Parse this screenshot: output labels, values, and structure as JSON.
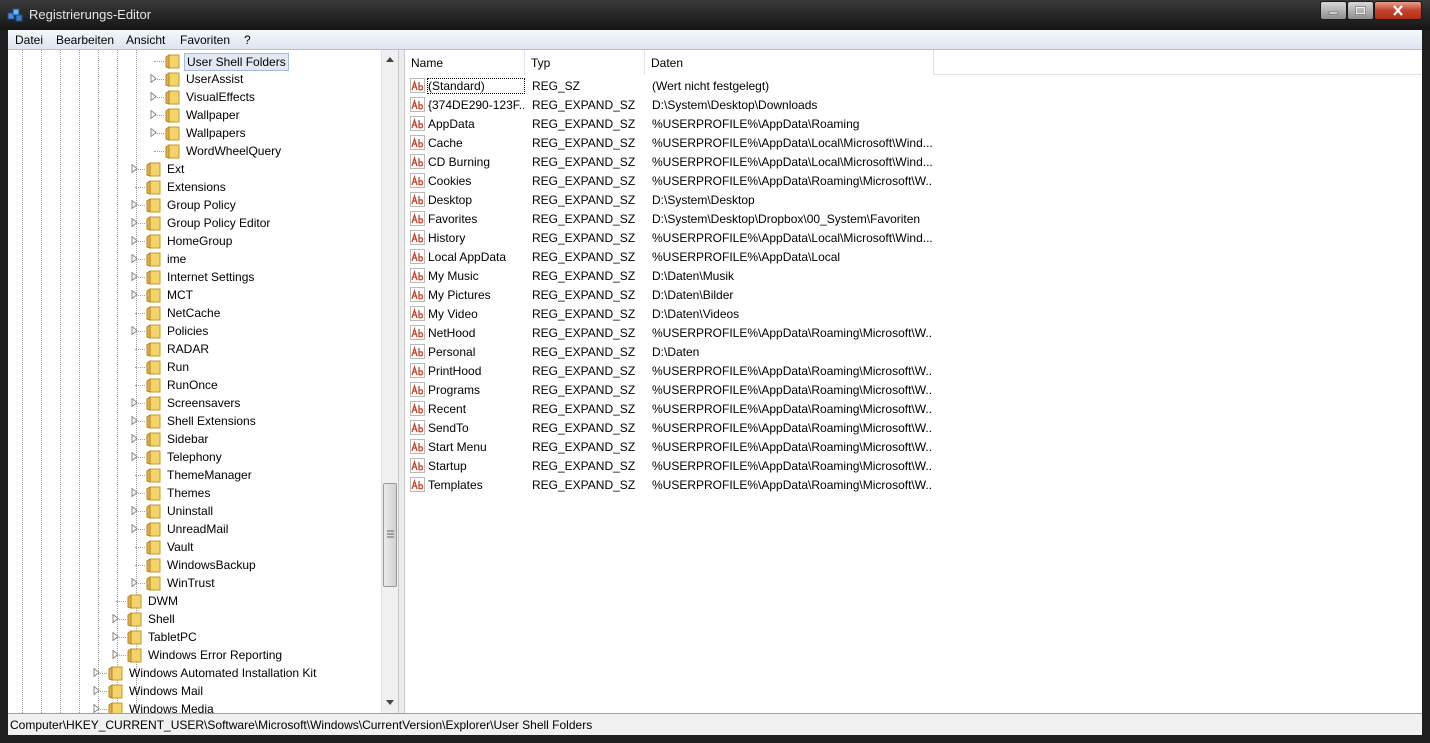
{
  "window": {
    "title": "Registrierungs-Editor"
  },
  "menu": [
    "Datei",
    "Bearbeiten",
    "Ansicht",
    "Favoriten",
    "?"
  ],
  "tree": {
    "nodes": [
      {
        "label": "User Shell Folders",
        "depth": 3,
        "expander": false,
        "selected": true
      },
      {
        "label": "UserAssist",
        "depth": 3,
        "expander": true
      },
      {
        "label": "VisualEffects",
        "depth": 3,
        "expander": true
      },
      {
        "label": "Wallpaper",
        "depth": 3,
        "expander": true
      },
      {
        "label": "Wallpapers",
        "depth": 3,
        "expander": true
      },
      {
        "label": "WordWheelQuery",
        "depth": 3,
        "expander": false
      },
      {
        "label": "Ext",
        "depth": 2,
        "expander": true
      },
      {
        "label": "Extensions",
        "depth": 2,
        "expander": false
      },
      {
        "label": "Group Policy",
        "depth": 2,
        "expander": true
      },
      {
        "label": "Group Policy Editor",
        "depth": 2,
        "expander": true
      },
      {
        "label": "HomeGroup",
        "depth": 2,
        "expander": true
      },
      {
        "label": "ime",
        "depth": 2,
        "expander": true
      },
      {
        "label": "Internet Settings",
        "depth": 2,
        "expander": true
      },
      {
        "label": "MCT",
        "depth": 2,
        "expander": true
      },
      {
        "label": "NetCache",
        "depth": 2,
        "expander": false
      },
      {
        "label": "Policies",
        "depth": 2,
        "expander": true
      },
      {
        "label": "RADAR",
        "depth": 2,
        "expander": false
      },
      {
        "label": "Run",
        "depth": 2,
        "expander": false
      },
      {
        "label": "RunOnce",
        "depth": 2,
        "expander": false
      },
      {
        "label": "Screensavers",
        "depth": 2,
        "expander": true
      },
      {
        "label": "Shell Extensions",
        "depth": 2,
        "expander": true
      },
      {
        "label": "Sidebar",
        "depth": 2,
        "expander": true
      },
      {
        "label": "Telephony",
        "depth": 2,
        "expander": true
      },
      {
        "label": "ThemeManager",
        "depth": 2,
        "expander": false
      },
      {
        "label": "Themes",
        "depth": 2,
        "expander": true
      },
      {
        "label": "Uninstall",
        "depth": 2,
        "expander": true
      },
      {
        "label": "UnreadMail",
        "depth": 2,
        "expander": true
      },
      {
        "label": "Vault",
        "depth": 2,
        "expander": false
      },
      {
        "label": "WindowsBackup",
        "depth": 2,
        "expander": false
      },
      {
        "label": "WinTrust",
        "depth": 2,
        "expander": true
      },
      {
        "label": "DWM",
        "depth": 1,
        "expander": false
      },
      {
        "label": "Shell",
        "depth": 1,
        "expander": true
      },
      {
        "label": "TabletPC",
        "depth": 1,
        "expander": true
      },
      {
        "label": "Windows Error Reporting",
        "depth": 1,
        "expander": true
      },
      {
        "label": "Windows Automated Installation Kit",
        "depth": 0,
        "expander": true
      },
      {
        "label": "Windows Mail",
        "depth": 0,
        "expander": true
      },
      {
        "label": "Windows Media",
        "depth": 0,
        "expander": true
      }
    ]
  },
  "list": {
    "columns": [
      "Name",
      "Typ",
      "Daten"
    ],
    "rows": [
      {
        "name": "(Standard)",
        "type": "REG_SZ",
        "data": "(Wert nicht festgelegt)"
      },
      {
        "name": "{374DE290-123F...",
        "type": "REG_EXPAND_SZ",
        "data": "D:\\System\\Desktop\\Downloads"
      },
      {
        "name": "AppData",
        "type": "REG_EXPAND_SZ",
        "data": "%USERPROFILE%\\AppData\\Roaming"
      },
      {
        "name": "Cache",
        "type": "REG_EXPAND_SZ",
        "data": "%USERPROFILE%\\AppData\\Local\\Microsoft\\Wind..."
      },
      {
        "name": "CD Burning",
        "type": "REG_EXPAND_SZ",
        "data": "%USERPROFILE%\\AppData\\Local\\Microsoft\\Wind..."
      },
      {
        "name": "Cookies",
        "type": "REG_EXPAND_SZ",
        "data": "%USERPROFILE%\\AppData\\Roaming\\Microsoft\\W..."
      },
      {
        "name": "Desktop",
        "type": "REG_EXPAND_SZ",
        "data": "D:\\System\\Desktop"
      },
      {
        "name": "Favorites",
        "type": "REG_EXPAND_SZ",
        "data": "D:\\System\\Desktop\\Dropbox\\00_System\\Favoriten"
      },
      {
        "name": "History",
        "type": "REG_EXPAND_SZ",
        "data": "%USERPROFILE%\\AppData\\Local\\Microsoft\\Wind..."
      },
      {
        "name": "Local AppData",
        "type": "REG_EXPAND_SZ",
        "data": "%USERPROFILE%\\AppData\\Local"
      },
      {
        "name": "My Music",
        "type": "REG_EXPAND_SZ",
        "data": "D:\\Daten\\Musik"
      },
      {
        "name": "My Pictures",
        "type": "REG_EXPAND_SZ",
        "data": "D:\\Daten\\Bilder"
      },
      {
        "name": "My Video",
        "type": "REG_EXPAND_SZ",
        "data": "D:\\Daten\\Videos"
      },
      {
        "name": "NetHood",
        "type": "REG_EXPAND_SZ",
        "data": "%USERPROFILE%\\AppData\\Roaming\\Microsoft\\W..."
      },
      {
        "name": "Personal",
        "type": "REG_EXPAND_SZ",
        "data": "D:\\Daten"
      },
      {
        "name": "PrintHood",
        "type": "REG_EXPAND_SZ",
        "data": "%USERPROFILE%\\AppData\\Roaming\\Microsoft\\W..."
      },
      {
        "name": "Programs",
        "type": "REG_EXPAND_SZ",
        "data": "%USERPROFILE%\\AppData\\Roaming\\Microsoft\\W..."
      },
      {
        "name": "Recent",
        "type": "REG_EXPAND_SZ",
        "data": "%USERPROFILE%\\AppData\\Roaming\\Microsoft\\W..."
      },
      {
        "name": "SendTo",
        "type": "REG_EXPAND_SZ",
        "data": "%USERPROFILE%\\AppData\\Roaming\\Microsoft\\W..."
      },
      {
        "name": "Start Menu",
        "type": "REG_EXPAND_SZ",
        "data": "%USERPROFILE%\\AppData\\Roaming\\Microsoft\\W..."
      },
      {
        "name": "Startup",
        "type": "REG_EXPAND_SZ",
        "data": "%USERPROFILE%\\AppData\\Roaming\\Microsoft\\W..."
      },
      {
        "name": "Templates",
        "type": "REG_EXPAND_SZ",
        "data": "%USERPROFILE%\\AppData\\Roaming\\Microsoft\\W..."
      }
    ]
  },
  "status": {
    "path": "Computer\\HKEY_CURRENT_USER\\Software\\Microsoft\\Windows\\CurrentVersion\\Explorer\\User Shell Folders"
  },
  "icons": {
    "app": "registry-editor-icon",
    "folder": "folder-icon",
    "value": "string-value-icon",
    "expander": "expand-arrow-icon"
  },
  "colors": {
    "folder": "#f4d36b",
    "value_icon": "#c8442c",
    "selection": "#e0e9f5",
    "close_button": "#c4412a"
  }
}
